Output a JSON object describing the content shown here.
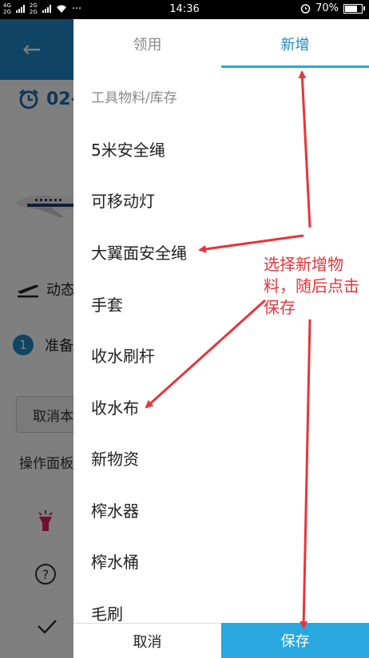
{
  "status_bar": {
    "network_top": "4G",
    "network_bottom": "2G",
    "network_top2": "2G",
    "network_bottom2": "2G",
    "more": "···",
    "time": "14:36",
    "battery_percent": "70%",
    "battery_level": 0.7
  },
  "background": {
    "date_partial": "02-",
    "dynamic_partial": "动态",
    "step_number": "1",
    "prepare_partial": "准备",
    "cancel_partial": "取消本",
    "operation_partial": "操作面板"
  },
  "drawer": {
    "tabs": [
      {
        "label": "领用",
        "active": false
      },
      {
        "label": "新增",
        "active": true
      }
    ],
    "list_header": "工具物料/库存",
    "items": [
      "5米安全绳",
      "可移动灯",
      "大翼面安全绳",
      "手套",
      "收水刷杆",
      "收水布",
      "新物资",
      "榨水器",
      "榨水桶",
      "毛刷"
    ],
    "cancel_label": "取消",
    "save_label": "保存"
  },
  "annotation": {
    "text": "选择新增物料，随后点击保存",
    "color": "#e8343a"
  },
  "colors": {
    "accent": "#29a8e0",
    "appbar": "#1e88c8"
  }
}
